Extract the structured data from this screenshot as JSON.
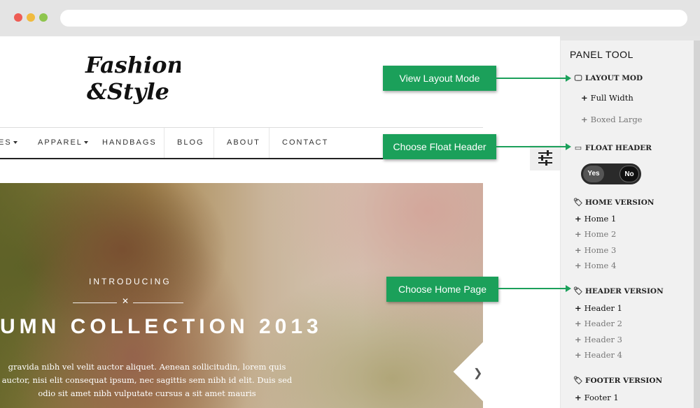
{
  "nav": {
    "items": [
      {
        "label": "ES",
        "dropdown": true
      },
      {
        "label": "APPAREL",
        "dropdown": true
      },
      {
        "label": "HANDBAGS",
        "dropdown": false
      },
      {
        "label": "BLOG",
        "dropdown": false
      },
      {
        "label": "ABOUT",
        "dropdown": false
      },
      {
        "label": "CONTACT",
        "dropdown": false
      }
    ]
  },
  "hero": {
    "intro": "INTRODUCING",
    "title": "UMN COLLECTION 2013",
    "text_lines": [
      "gravida nibh vel velit auctor aliquet. Aenean sollicitudin, lorem quis",
      "auctor, nisi elit consequat ipsum, nec sagittis sem nibh id elit. Duis sed",
      "odio sit amet nibh vulputate cursus a sit amet mauris"
    ]
  },
  "callouts": {
    "layout": "View Layout Mode",
    "float_header": "Choose Float Header",
    "home_page": "Choose Home Page"
  },
  "panel": {
    "title": "PANEL TOOL",
    "layout_mod": {
      "heading": "LAYOUT MOD",
      "options": [
        "Full Width",
        "Boxed Large"
      ]
    },
    "float_header": {
      "heading": "FLOAT HEADER",
      "yes": "Yes",
      "no": "No",
      "selected": "No"
    },
    "home_version": {
      "heading": "HOME VERSION",
      "options": [
        "Home 1",
        "Home 2",
        "Home 3",
        "Home 4"
      ]
    },
    "header_version": {
      "heading": "HEADER VERSION",
      "options": [
        "Header 1",
        "Header 2",
        "Header 3",
        "Header 4"
      ]
    },
    "footer_version": {
      "heading": "FOOTER VERSION",
      "options": [
        "Footer 1"
      ]
    }
  },
  "colors": {
    "callout_green": "#1ba05a",
    "panel_bg": "#f1f1f1"
  }
}
